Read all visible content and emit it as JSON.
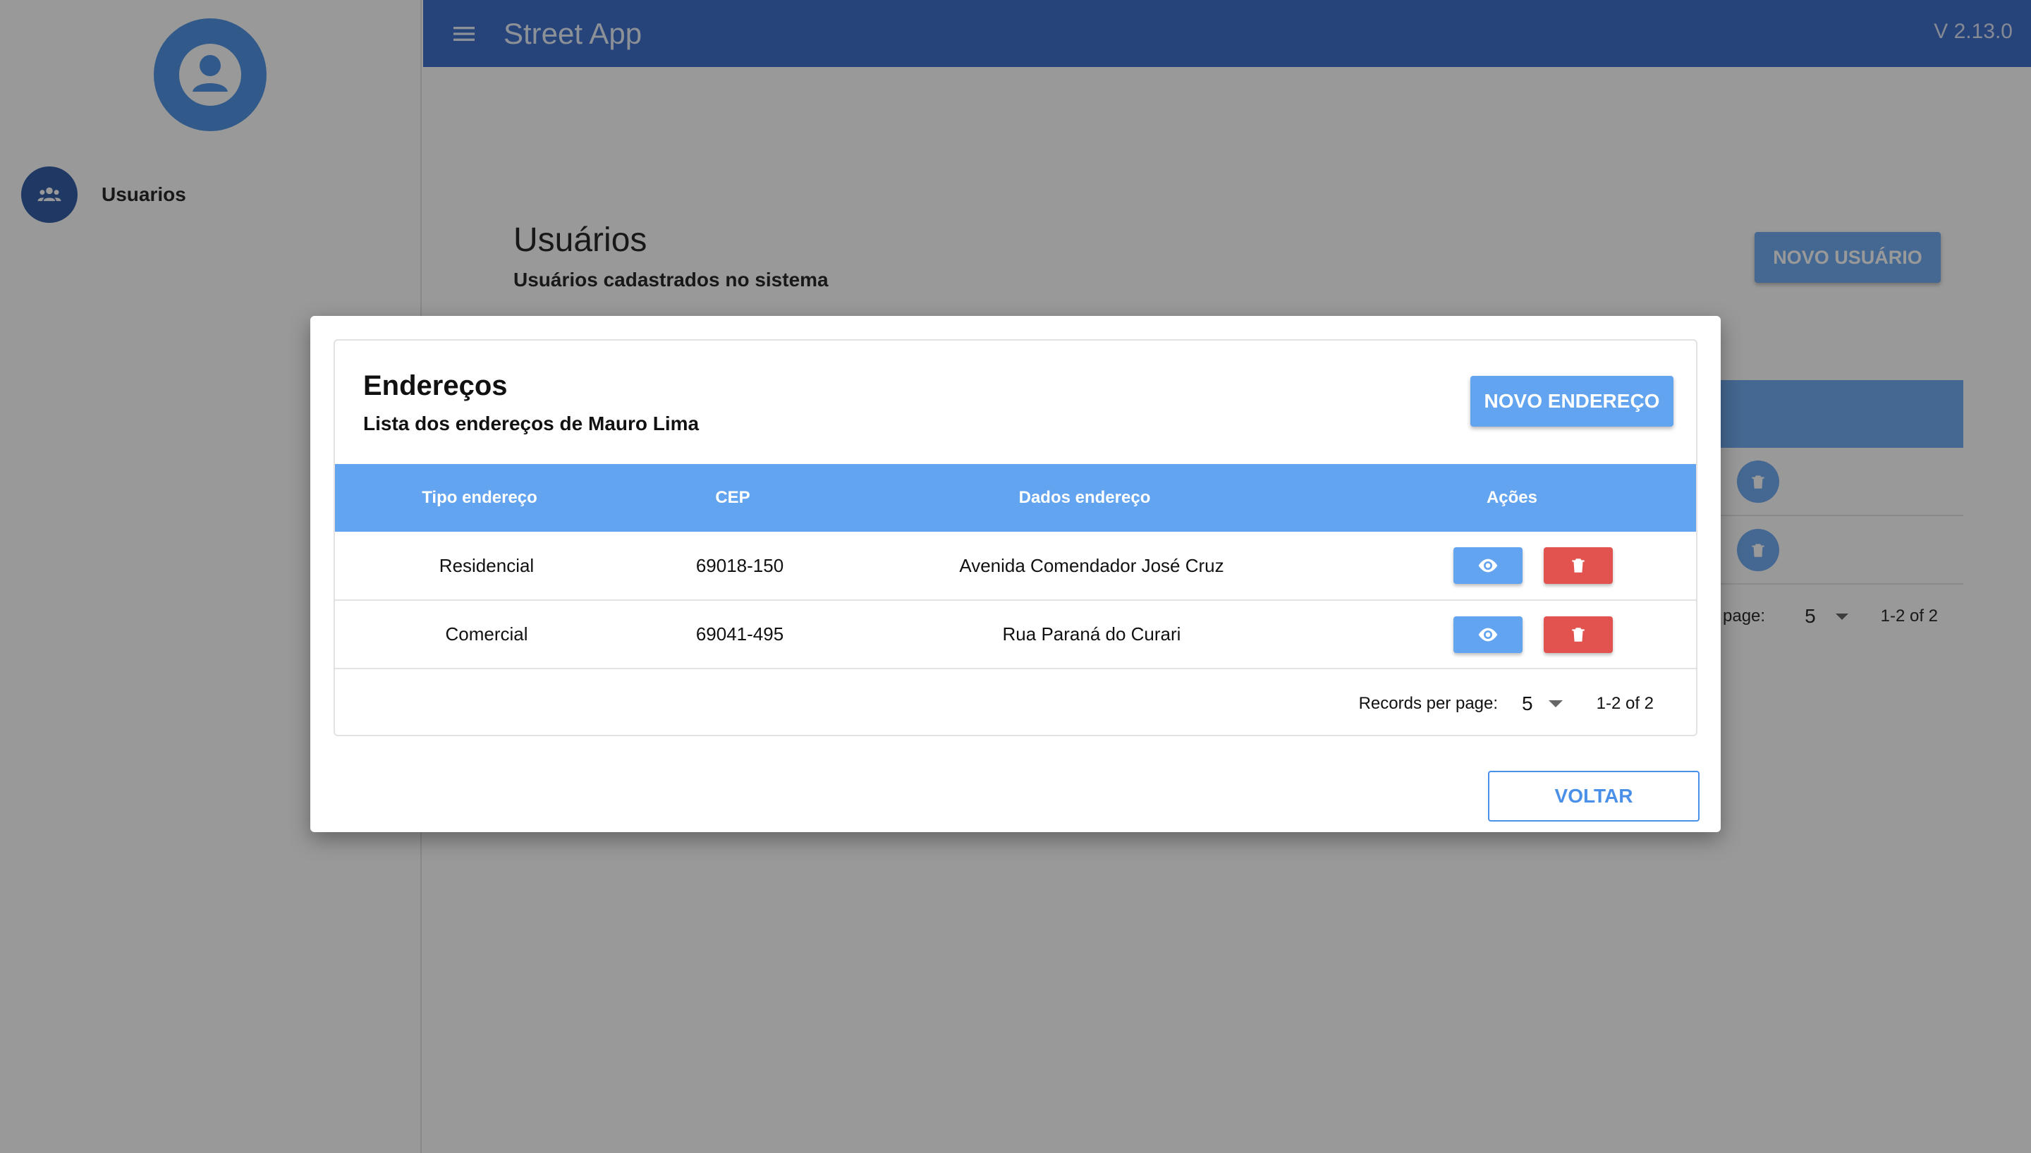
{
  "sidebar": {
    "avatar_icon": "account-circle-icon",
    "items": [
      {
        "icon": "group-icon",
        "label": "Usuarios"
      }
    ]
  },
  "appbar": {
    "menu_icon": "menu-icon",
    "title": "Street App",
    "version": "V 2.13.0"
  },
  "page": {
    "title": "Usuários",
    "subtitle": "Usuários cadastrados no sistema",
    "new_user_label": "NOVO USUÁRIO",
    "pagination": {
      "label_partial": "page:",
      "per_page": "5",
      "range": "1-2 of 2"
    }
  },
  "dialog": {
    "title": "Endereços",
    "subtitle": "Lista dos endereços de Mauro Lima",
    "new_address_label": "NOVO ENDEREÇO",
    "columns": [
      "Tipo endereço",
      "CEP",
      "Dados endereço",
      "Ações"
    ],
    "rows": [
      {
        "tipo": "Residencial",
        "cep": "69018-150",
        "dados": "Avenida Comendador José Cruz"
      },
      {
        "tipo": "Comercial",
        "cep": "69041-495",
        "dados": "Rua Paraná do Curari"
      }
    ],
    "pagination": {
      "label": "Records per page:",
      "per_page": "5",
      "range": "1-2 of 2"
    },
    "back_label": "VOLTAR"
  },
  "colors": {
    "appbar": "#2c62c6",
    "primary": "#63a4f0",
    "danger": "#e2534f",
    "nav_icon_bg": "#1e4d9e"
  }
}
